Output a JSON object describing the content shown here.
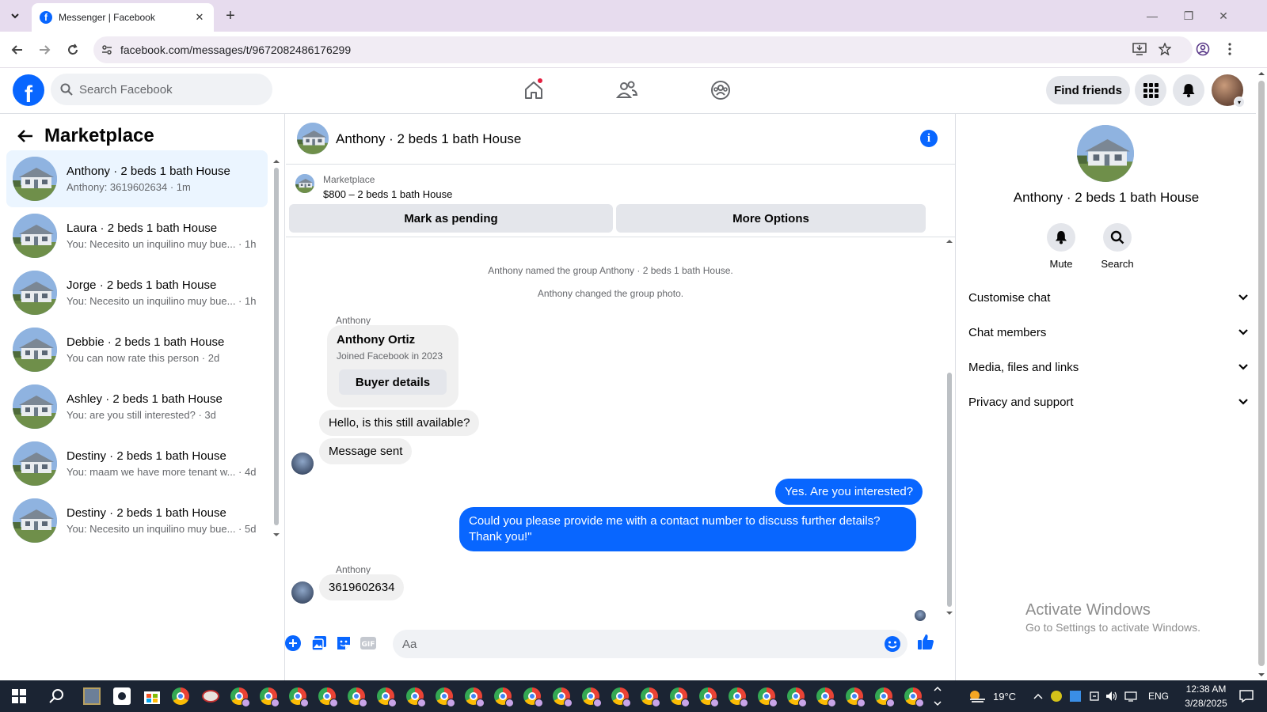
{
  "browser": {
    "tab_title": "Messenger | Facebook",
    "url": "facebook.com/messages/t/9672082486176299"
  },
  "fb": {
    "search_placeholder": "Search Facebook",
    "find_friends": "Find friends"
  },
  "sidebar": {
    "title": "Marketplace",
    "conversations": [
      {
        "name": "Anthony · 2 beds 1 bath House",
        "preview": "Anthony: 3619602634 · 1m",
        "active": true
      },
      {
        "name": "Laura · 2 beds 1 bath House",
        "preview": "You: Necesito un inquilino muy bue... · 1h"
      },
      {
        "name": "Jorge · 2 beds 1 bath House",
        "preview": "You: Necesito un inquilino muy bue... · 1h"
      },
      {
        "name": "Debbie · 2 beds 1 bath House",
        "preview": "You can now rate this person · 2d"
      },
      {
        "name": "Ashley · 2 beds 1 bath House",
        "preview": "You: are you still interested? · 3d"
      },
      {
        "name": "Destiny · 2 beds 1 bath House",
        "preview": "You: maam we have more tenant w... · 4d"
      },
      {
        "name": "Destiny · 2 beds 1 bath House",
        "preview": "You: Necesito un inquilino muy bue... · 5d"
      }
    ]
  },
  "chat": {
    "title": "Anthony · 2 beds 1 bath House",
    "marketplace_label": "Marketplace",
    "listing": "$800 – 2 beds 1 bath House",
    "mark_pending": "Mark as pending",
    "more_options": "More Options",
    "system_1": "Anthony named the group Anthony · 2 beds 1 bath House.",
    "system_2": "Anthony changed the group photo.",
    "sender_1": "Anthony",
    "card_name": "Anthony Ortiz",
    "card_sub": "Joined Facebook in 2023",
    "card_button": "Buyer details",
    "msg_1": "Hello, is this still available?",
    "msg_2": "Message sent",
    "out_1": "Yes. Are you interested?",
    "out_2": "Could you please provide me with a contact number to discuss further details? Thank you!\"",
    "sender_2": "Anthony",
    "msg_3": "3619602634",
    "composer_placeholder": "Aa"
  },
  "info": {
    "name": "Anthony · 2 beds 1 bath House",
    "mute": "Mute",
    "search": "Search",
    "sections": [
      "Customise chat",
      "Chat members",
      "Media, files and links",
      "Privacy and support"
    ],
    "activate_title": "Activate Windows",
    "activate_sub": "Go to Settings to activate Windows."
  },
  "taskbar": {
    "weather": "19°C",
    "lang": "ENG",
    "time": "12:38 AM",
    "date": "3/28/2025"
  },
  "colors": {
    "accent": "#0866ff",
    "active_row": "#ebf5ff"
  }
}
